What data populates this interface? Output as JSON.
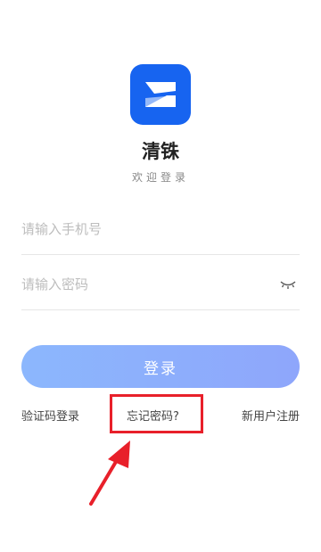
{
  "app": {
    "name": "清铢",
    "welcome": "欢迎登录",
    "logo_icon": "zigzag-z-logo",
    "brand_color": "#1764f0"
  },
  "form": {
    "phone_placeholder": "请输入手机号",
    "phone_value": "",
    "password_placeholder": "请输入密码",
    "password_value": "",
    "password_toggle_icon": "eye-closed-icon",
    "login_label": "登录"
  },
  "links": {
    "sms_login": "验证码登录",
    "forgot_password": "忘记密码?",
    "register": "新用户注册"
  },
  "annotation": {
    "highlight_color": "#e8202a",
    "arrow_icon": "red-arrow-pointer"
  }
}
